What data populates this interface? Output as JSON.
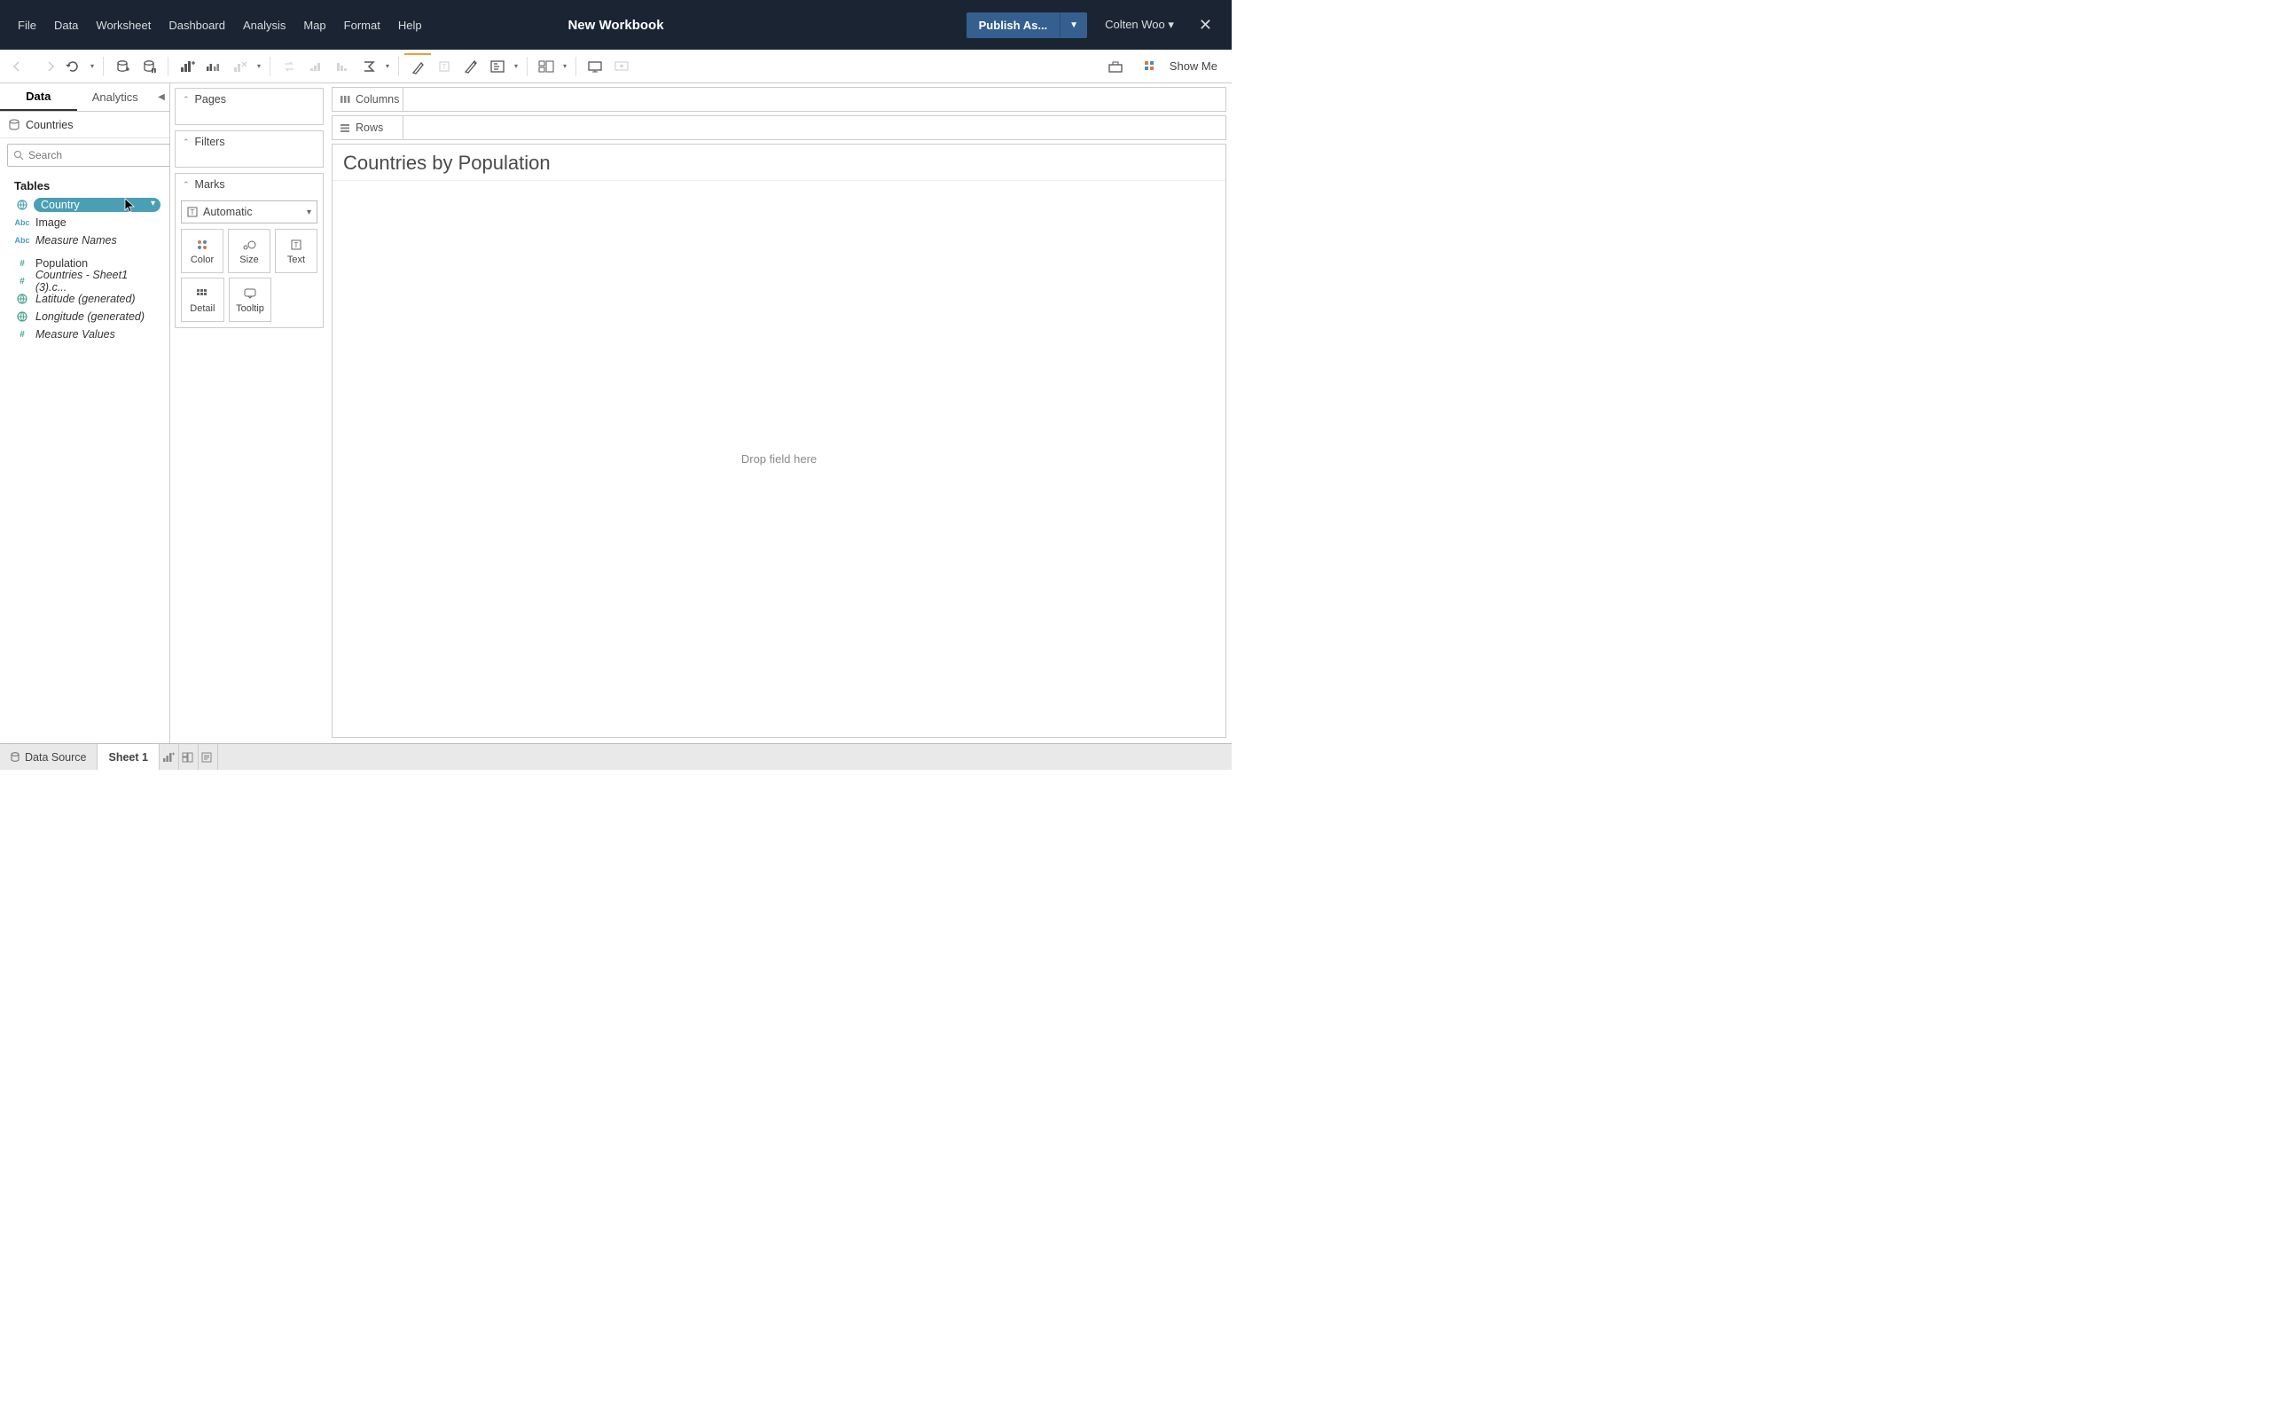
{
  "titlebar": {
    "title": "New Workbook",
    "menus": [
      "File",
      "Data",
      "Worksheet",
      "Dashboard",
      "Analysis",
      "Map",
      "Format",
      "Help"
    ],
    "publish_label": "Publish As...",
    "user_name": "Colten Woo"
  },
  "toolbar": {
    "showme_label": "Show Me"
  },
  "sidebar": {
    "tabs": {
      "data": "Data",
      "analytics": "Analytics"
    },
    "datasource": "Countries",
    "search_placeholder": "Search",
    "tables_header": "Tables",
    "fields": [
      {
        "icon": "globe",
        "label": "Country",
        "selected": true
      },
      {
        "icon": "abc",
        "label": "Image"
      },
      {
        "icon": "abc",
        "label": "Measure Names",
        "italic": true
      },
      {
        "icon": "hash",
        "label": "Population",
        "gap_before": true
      },
      {
        "icon": "hash",
        "label": "Countries - Sheet1 (3).c...",
        "italic": true
      },
      {
        "icon": "globe",
        "label": "Latitude (generated)",
        "italic": true
      },
      {
        "icon": "globe",
        "label": "Longitude (generated)",
        "italic": true
      },
      {
        "icon": "hash",
        "label": "Measure Values",
        "italic": true
      }
    ]
  },
  "cards": {
    "pages": "Pages",
    "filters": "Filters",
    "marks": "Marks",
    "marks_select": "Automatic",
    "mark_cells": [
      "Color",
      "Size",
      "Text",
      "Detail",
      "Tooltip"
    ]
  },
  "shelves": {
    "columns": "Columns",
    "rows": "Rows"
  },
  "viz": {
    "title": "Countries by Population",
    "drop_hint": "Drop field here"
  },
  "bottom": {
    "datasource": "Data Source",
    "sheet": "Sheet 1"
  }
}
